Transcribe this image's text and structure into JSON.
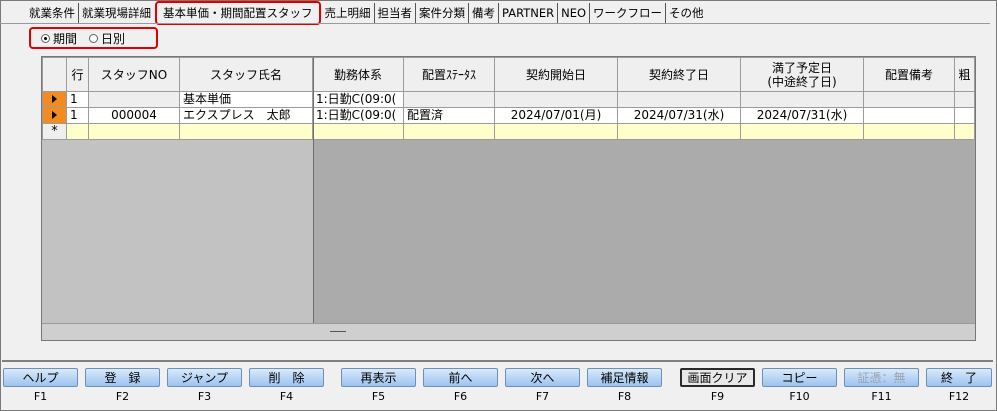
{
  "tabs": [
    {
      "label": "就業条件"
    },
    {
      "label": "就業現場詳細"
    },
    {
      "label": "基本単価・期間配置スタッフ",
      "active": true
    },
    {
      "label": "売上明細"
    },
    {
      "label": "担当者"
    },
    {
      "label": "案件分類"
    },
    {
      "label": "備考"
    },
    {
      "label": "PARTNER"
    },
    {
      "label": "NEO"
    },
    {
      "label": "ワークフロー"
    },
    {
      "label": "その他"
    }
  ],
  "radio": {
    "options": [
      {
        "label": "期間",
        "checked": true
      },
      {
        "label": "日別",
        "checked": false
      }
    ]
  },
  "grid": {
    "columns": [
      "行",
      "スタッフNO",
      "スタッフ氏名",
      "勤務体系",
      "配置ｽﾃｰﾀｽ",
      "契約開始日",
      "契約終了日",
      "満了予定日\n(中途終了日)",
      "配置備考",
      "粗"
    ],
    "rows": [
      {
        "row": "1",
        "staff_no": "",
        "staff_name": "基本単価",
        "work": "1:日勤C(09:0(",
        "status": "",
        "start": "",
        "end": "",
        "expire": "",
        "note": ""
      },
      {
        "row": "1",
        "staff_no": "000004",
        "staff_name": "エクスプレス　太郎",
        "work": "1:日勤C(09:0(",
        "status": "配置済",
        "start": "2024/07/01(月)",
        "end": "2024/07/31(水)",
        "expire": "2024/07/31(水)",
        "note": ""
      }
    ],
    "new_row_marker": "*"
  },
  "fkeys": [
    {
      "label": "ヘルプ",
      "key": "F1"
    },
    {
      "label": "登　録",
      "key": "F2"
    },
    {
      "label": "ジャンプ",
      "key": "F3"
    },
    {
      "label": "削　除",
      "key": "F4"
    },
    {
      "label": "再表示",
      "key": "F5"
    },
    {
      "label": "前へ",
      "key": "F6"
    },
    {
      "label": "次へ",
      "key": "F7"
    },
    {
      "label": "補足情報",
      "key": "F8"
    },
    {
      "label": "画面クリア",
      "key": "F9",
      "active": true
    },
    {
      "label": "コピー",
      "key": "F10"
    },
    {
      "label": "証憑：無",
      "key": "F11",
      "disabled": true
    },
    {
      "label": "終　了",
      "key": "F12"
    }
  ]
}
